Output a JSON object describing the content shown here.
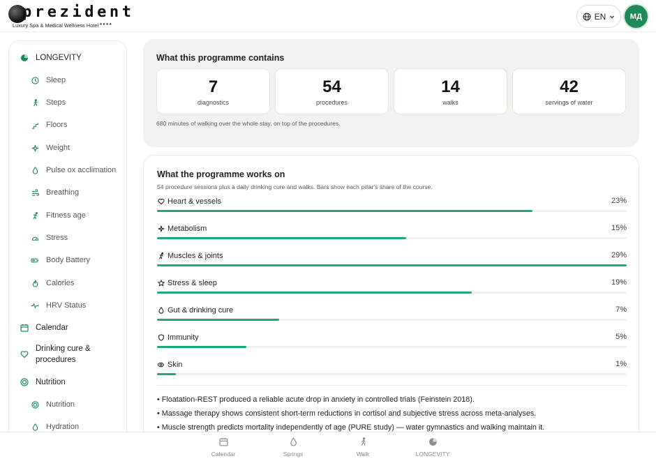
{
  "brand": {
    "name": "prezident",
    "tagline": "Luxury Spa & Medical Wellness Hotel",
    "stars": "★★★★"
  },
  "header": {
    "language": "EN",
    "avatar_initials": "МД"
  },
  "sidebar": {
    "items": [
      {
        "label": "LONGEVITY",
        "icon": "longevity-icon",
        "level": 0
      },
      {
        "label": "Sleep",
        "icon": "clock-icon",
        "level": 1
      },
      {
        "label": "Steps",
        "icon": "walking-icon",
        "level": 1
      },
      {
        "label": "Floors",
        "icon": "stairs-icon",
        "level": 1
      },
      {
        "label": "Weight",
        "icon": "weight-icon",
        "level": 1
      },
      {
        "label": "Pulse ox acclimation",
        "icon": "droplet-icon",
        "level": 1
      },
      {
        "label": "Breathing",
        "icon": "wind-icon",
        "level": 1
      },
      {
        "label": "Fitness age",
        "icon": "running-icon",
        "level": 1
      },
      {
        "label": "Stress",
        "icon": "gauge-icon",
        "level": 1
      },
      {
        "label": "Body Battery",
        "icon": "battery-icon",
        "level": 1
      },
      {
        "label": "Calories",
        "icon": "flame-icon",
        "level": 1
      },
      {
        "label": "HRV Status",
        "icon": "pulse-icon",
        "level": 1
      },
      {
        "label": "Calendar",
        "icon": "calendar-icon",
        "level": 0
      },
      {
        "label": "Drinking cure & procedures",
        "icon": "heart-icon",
        "level": 0
      },
      {
        "label": "Nutrition",
        "icon": "target-icon",
        "level": 0
      },
      {
        "label": "Nutrition",
        "icon": "target-icon",
        "level": 1
      },
      {
        "label": "Hydration",
        "icon": "droplet-icon",
        "level": 1
      }
    ]
  },
  "contains": {
    "title": "What this programme contains",
    "stats": [
      {
        "value": "7",
        "label": "diagnostics"
      },
      {
        "value": "54",
        "label": "procedures"
      },
      {
        "value": "14",
        "label": "walks"
      },
      {
        "value": "42",
        "label": "servings of water"
      }
    ],
    "note": "680 minutes of walking over the whole stay, on top of the procedures."
  },
  "works": {
    "title": "What the programme works on",
    "subtitle": "54 procedure sessions plus a daily drinking cure and walks. Bars show each pillar's share of the course.",
    "pillars": [
      {
        "label": "Heart & vessels",
        "pct_label": "23%",
        "fill": 0.8,
        "icon": "heart-icon"
      },
      {
        "label": "Metabolism",
        "pct_label": "15%",
        "fill": 0.53,
        "icon": "sparkle-icon"
      },
      {
        "label": "Muscles & joints",
        "pct_label": "29%",
        "fill": 1.0,
        "icon": "running-icon"
      },
      {
        "label": "Stress & sleep",
        "pct_label": "19%",
        "fill": 0.67,
        "icon": "star-icon"
      },
      {
        "label": "Gut & drinking cure",
        "pct_label": "7%",
        "fill": 0.26,
        "icon": "droplet-icon"
      },
      {
        "label": "Immunity",
        "pct_label": "5%",
        "fill": 0.19,
        "icon": "shield-icon"
      },
      {
        "label": "Skin",
        "pct_label": "1%",
        "fill": 0.04,
        "icon": "eye-icon"
      }
    ],
    "facts": [
      "• Floatation-REST produced a reliable acute drop in anxiety in controlled trials (Feinstein 2018).",
      "• Massage therapy shows consistent short-term reductions in cortisol and subjective stress across meta-analyses.",
      "• Muscle strength predicts mortality independently of age (PURE study) — water gymnastics and walking maintain it."
    ]
  },
  "bottom_nav": {
    "items": [
      {
        "label": "Calendar",
        "icon": "calendar-icon"
      },
      {
        "label": "Springs",
        "icon": "droplet-icon"
      },
      {
        "label": "Walk",
        "icon": "walking-icon"
      },
      {
        "label": "LONGEVITY",
        "icon": "longevity-icon"
      }
    ]
  },
  "colors": {
    "accent": "#20a876",
    "avatar": "#1e8a5a",
    "panel": "#f1f2ee"
  }
}
